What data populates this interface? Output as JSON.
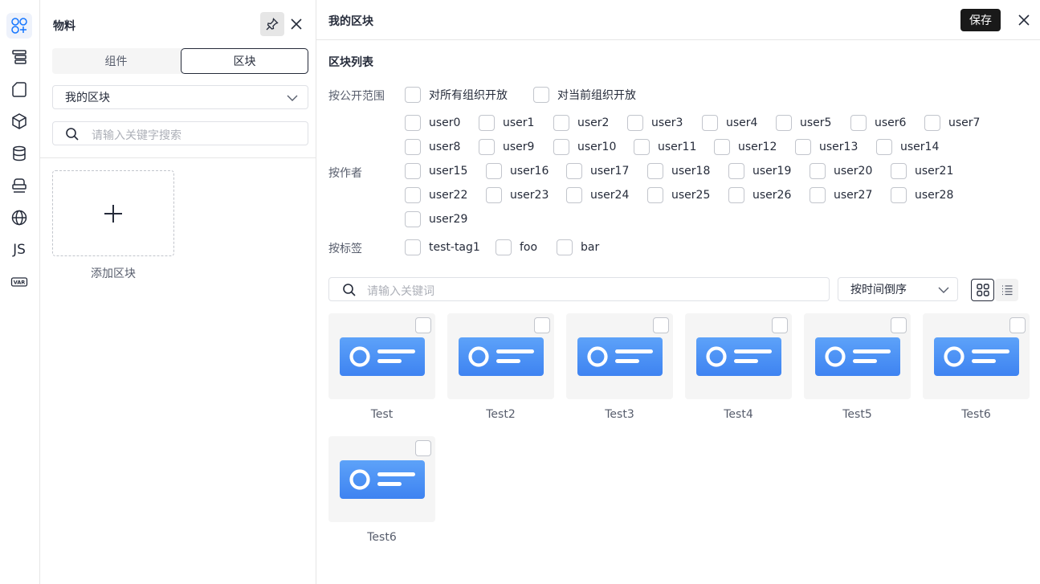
{
  "activity_bar": {
    "items": [
      {
        "name": "materials-icon",
        "active": true
      },
      {
        "name": "outline-icon"
      },
      {
        "name": "page-icon"
      },
      {
        "name": "block-icon"
      },
      {
        "name": "datasource-icon"
      },
      {
        "name": "bridge-icon"
      },
      {
        "name": "globe-icon"
      },
      {
        "name": "js-icon",
        "label": "JS"
      },
      {
        "name": "var-icon",
        "label": "VAR"
      }
    ]
  },
  "materials": {
    "title": "物料",
    "tabs": [
      "组件",
      "区块"
    ],
    "active_tab": "区块",
    "group_select": "我的区块",
    "search_placeholder": "请输入关键字搜索",
    "add_block_label": "添加区块"
  },
  "block_panel": {
    "title": "我的区块",
    "save_label": "保存",
    "section_title": "区块列表",
    "filters": {
      "scope": {
        "label": "按公开范围",
        "options": [
          "对所有组织开放",
          "对当前组织开放"
        ]
      },
      "author": {
        "label": "按作者",
        "options": [
          "user0",
          "user1",
          "user2",
          "user3",
          "user4",
          "user5",
          "user6",
          "user7",
          "user8",
          "user9",
          "user10",
          "user11",
          "user12",
          "user13",
          "user14",
          "user15",
          "user16",
          "user17",
          "user18",
          "user19",
          "user20",
          "user21",
          "user22",
          "user23",
          "user24",
          "user25",
          "user26",
          "user27",
          "user28",
          "user29"
        ]
      },
      "tags": {
        "label": "按标签",
        "options": [
          "test-tag1",
          "foo",
          "bar"
        ]
      }
    },
    "keyword_placeholder": "请输入关键词",
    "sort_value": "按时间倒序",
    "view_mode": "grid",
    "blocks": [
      {
        "name": "Test"
      },
      {
        "name": "Test2"
      },
      {
        "name": "Test3"
      },
      {
        "name": "Test4"
      },
      {
        "name": "Test5"
      },
      {
        "name": "Test6"
      },
      {
        "name": "Test6"
      }
    ]
  },
  "colors": {
    "accent": "#1476ff",
    "thumb_gradient_top": "#5da2f9",
    "thumb_gradient_bottom": "#3e83f1",
    "dark_button": "#191919"
  }
}
